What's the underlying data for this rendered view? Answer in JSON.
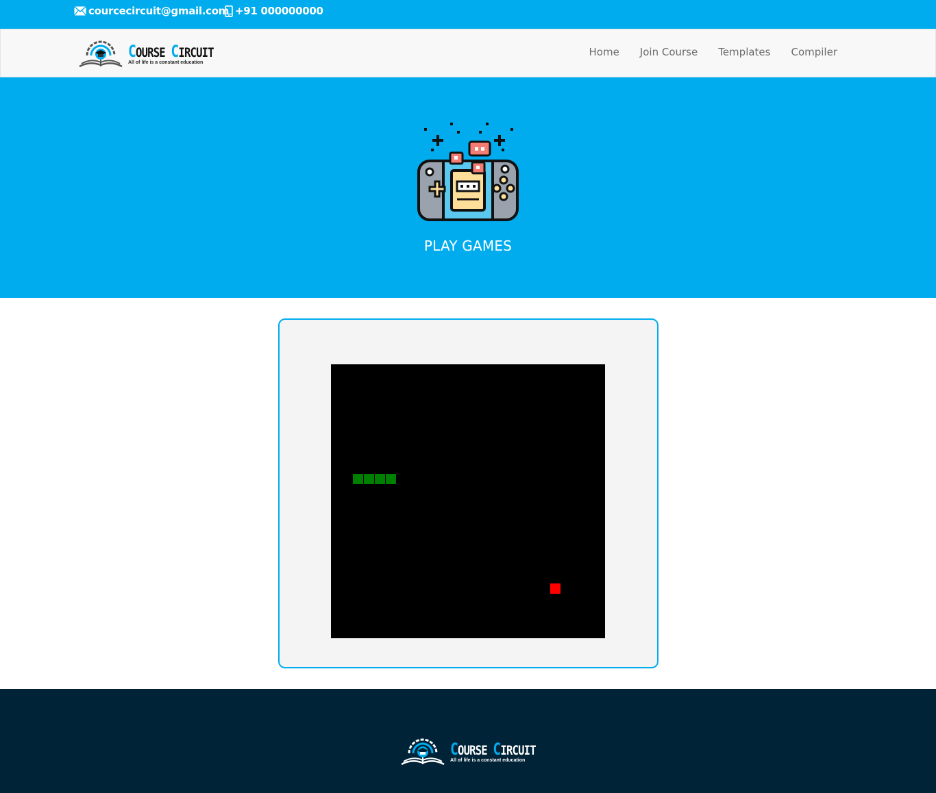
{
  "topbar": {
    "email": "courcecircuit@gmail.com",
    "phone": "+91 000000000",
    "email_icon": "envelope-icon",
    "phone_icon": "mobile-phone-icon"
  },
  "brand": {
    "name_first_cap": "C",
    "name_first_rest": "OURSE ",
    "name_second_cap": "C",
    "name_second_rest": "IRCUIT",
    "tagline": "All of life is a constant education",
    "logo_icon": "graduation-book-logo-icon"
  },
  "nav": {
    "items": [
      {
        "label": "Home"
      },
      {
        "label": "Join Course"
      },
      {
        "label": "Templates"
      },
      {
        "label": "Compiler"
      }
    ]
  },
  "hero": {
    "icon": "game-console-icon",
    "title": "PLAY GAMES"
  },
  "game": {
    "type": "snake",
    "grid_cells": 25,
    "snake_cells": [
      [
        2,
        10
      ],
      [
        3,
        10
      ],
      [
        4,
        10
      ],
      [
        5,
        10
      ]
    ],
    "food_cell": [
      20,
      20
    ]
  },
  "colors": {
    "primary": "#00aced",
    "footer_bg": "#002337",
    "snake": "#008000",
    "food": "#ff0000",
    "board": "#000000"
  }
}
